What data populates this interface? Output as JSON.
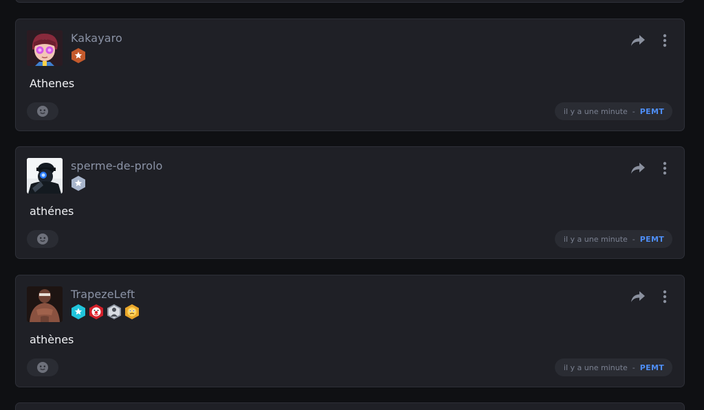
{
  "posts": [
    {
      "username": "Kakayaro",
      "message": "Athenes",
      "timestamp": "il y a une minute",
      "separator": "-",
      "tag": "PEMT",
      "badges": [
        "bronze-star-badge-icon"
      ]
    },
    {
      "username": "sperme-de-prolo",
      "message": "athénes",
      "timestamp": "il y a une minute",
      "separator": "-",
      "tag": "PEMT",
      "badges": [
        "silver-star-badge-icon"
      ]
    },
    {
      "username": "TrapezeLeft",
      "message": "athènes",
      "timestamp": "il y a une minute",
      "separator": "-",
      "tag": "PEMT",
      "badges": [
        "cyan-star-badge-icon",
        "red-clown-badge-icon",
        "gray-figure-badge-icon",
        "gold-face-badge-icon"
      ]
    }
  ],
  "colors": {
    "background": "#0f1013",
    "card": "#1f2026",
    "card_border": "#2e3038",
    "username": "#8b93a6",
    "message": "#f0f1f4",
    "timestamp": "#7b8191",
    "tag": "#4e8ef7",
    "pill": "#2a2c33"
  },
  "icons": {
    "share": "share-arrow-icon",
    "menu": "kebab-menu-icon",
    "reaction": "smiley-reaction-icon"
  }
}
